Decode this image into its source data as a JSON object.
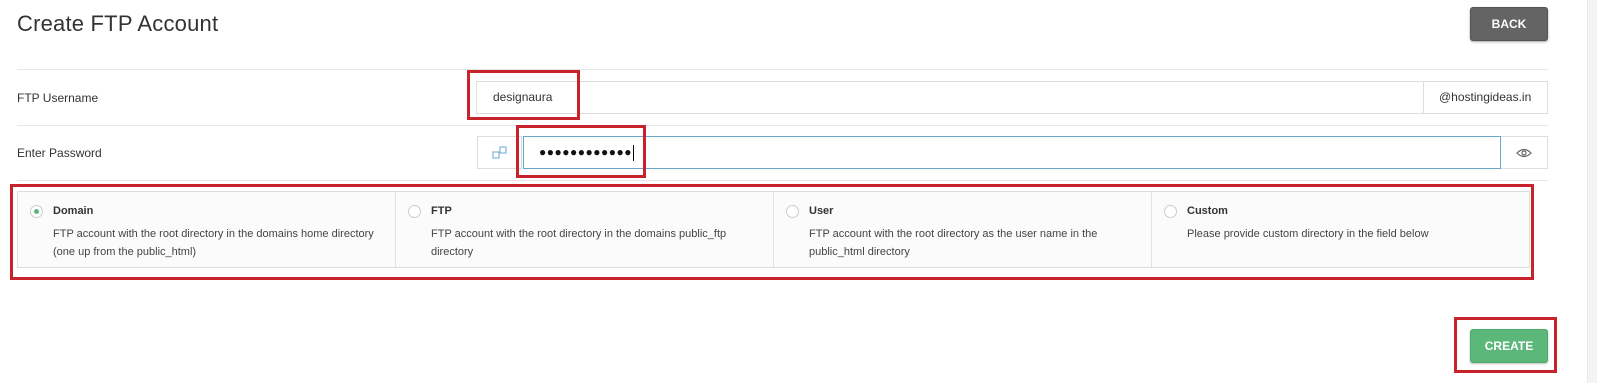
{
  "page": {
    "title": "Create FTP Account",
    "back_label": "BACK",
    "create_label": "CREATE"
  },
  "username": {
    "label": "FTP Username",
    "value": "designaura",
    "domain_suffix": "@hostingideas.in"
  },
  "password": {
    "label": "Enter Password",
    "masked_value": "●●●●●●●●●●●●"
  },
  "directory_options": [
    {
      "title": "Domain",
      "description": "FTP account with the root directory in the domains home directory (one up from the public_html)",
      "selected": true
    },
    {
      "title": "FTP",
      "description": "FTP account with the root directory in the domains public_ftp directory",
      "selected": false
    },
    {
      "title": "User",
      "description": "FTP account with the root directory as the user name in the public_html directory",
      "selected": false
    },
    {
      "title": "Custom",
      "description": "Please provide custom directory in the field below",
      "selected": false
    }
  ],
  "colors": {
    "accent_green": "#5cb87a",
    "back_button": "#646464",
    "annotation_red": "#c8232c",
    "focus_border": "#6aa8c8"
  },
  "icons": {
    "password_generator": "key-generator-icon",
    "show_password": "eye-icon"
  }
}
